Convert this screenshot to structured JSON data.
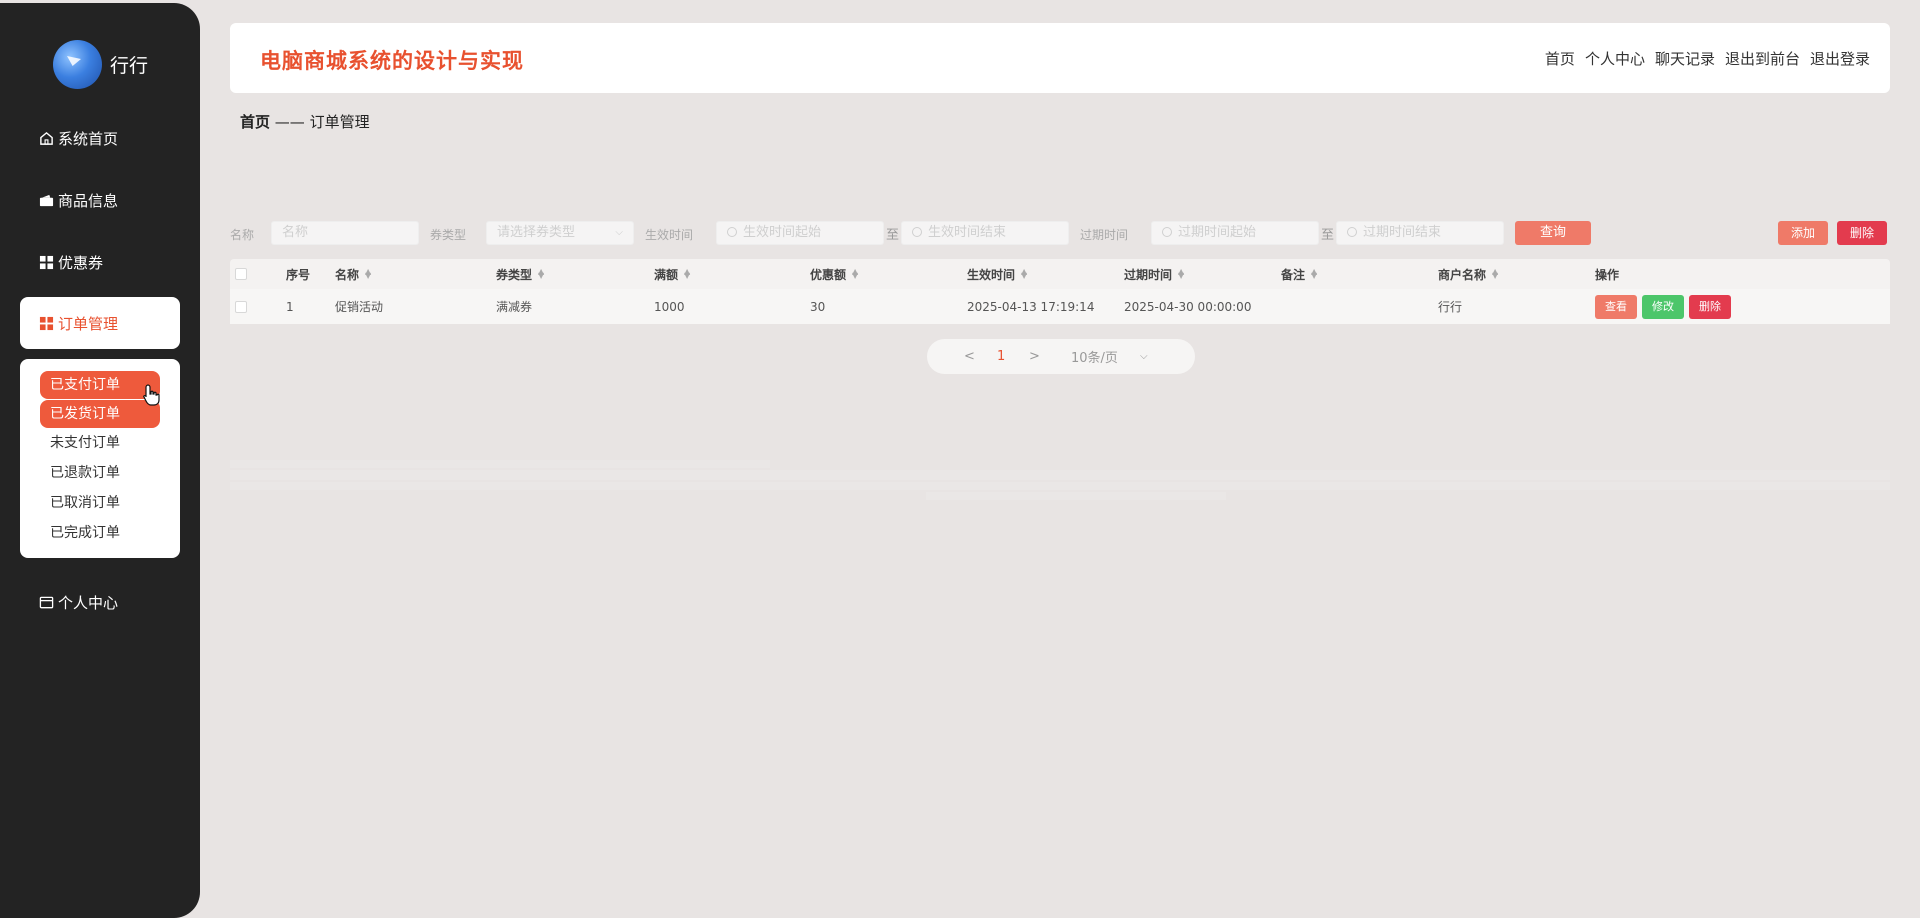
{
  "sidebar": {
    "brand_name": "行行",
    "items": [
      {
        "label": "系统首页",
        "icon": "home-icon"
      },
      {
        "label": "商品信息",
        "icon": "wallet-icon"
      },
      {
        "label": "优惠券",
        "icon": "grid-icon"
      },
      {
        "label": "订单管理",
        "icon": "grid-icon"
      },
      {
        "label": "个人中心",
        "icon": "card-icon"
      }
    ],
    "submenu": [
      "已支付订单",
      "已发货订单",
      "未支付订单",
      "已退款订单",
      "已取消订单",
      "已完成订单"
    ]
  },
  "header": {
    "title": "电脑商城系统的设计与实现",
    "links": [
      "首页",
      "个人中心",
      "聊天记录",
      "退出到前台",
      "退出登录"
    ]
  },
  "breadcrumb": {
    "home": "首页",
    "sep": " —— ",
    "current": "订单管理"
  },
  "filters": {
    "name_label": "名称",
    "name_placeholder": "名称",
    "type_label": "券类型",
    "type_placeholder": "请选择券类型",
    "start_label": "生效时间",
    "start_from_placeholder": "生效时间起始",
    "start_to_placeholder": "生效时间结束",
    "to": "至",
    "expire_label": "过期时间",
    "expire_from_placeholder": "过期时间起始",
    "expire_to_placeholder": "过期时间结束",
    "query_label": "查询",
    "add_label": "添加",
    "delete_label": "删除"
  },
  "table": {
    "columns": [
      "序号",
      "名称",
      "券类型",
      "满额",
      "优惠额",
      "生效时间",
      "过期时间",
      "备注",
      "商户名称",
      "操作"
    ],
    "rows": [
      {
        "index": "1",
        "name": "促销活动",
        "type": "满减券",
        "threshold": "1000",
        "discount": "30",
        "start": "2025-04-13 17:19:14",
        "expire": "2025-04-30 00:00:00",
        "note": "",
        "merchant": "行行"
      }
    ],
    "actions": {
      "view": "查看",
      "edit": "修改",
      "delete": "删除"
    }
  },
  "pager": {
    "prev": "<",
    "page": "1",
    "next": ">",
    "size": "10条/页"
  },
  "colors": {
    "accent": "#e8512f",
    "sidebar_bg": "#232323",
    "danger": "#e33b4e",
    "success": "#4cc66a",
    "soft_accent": "#ef7a68"
  }
}
